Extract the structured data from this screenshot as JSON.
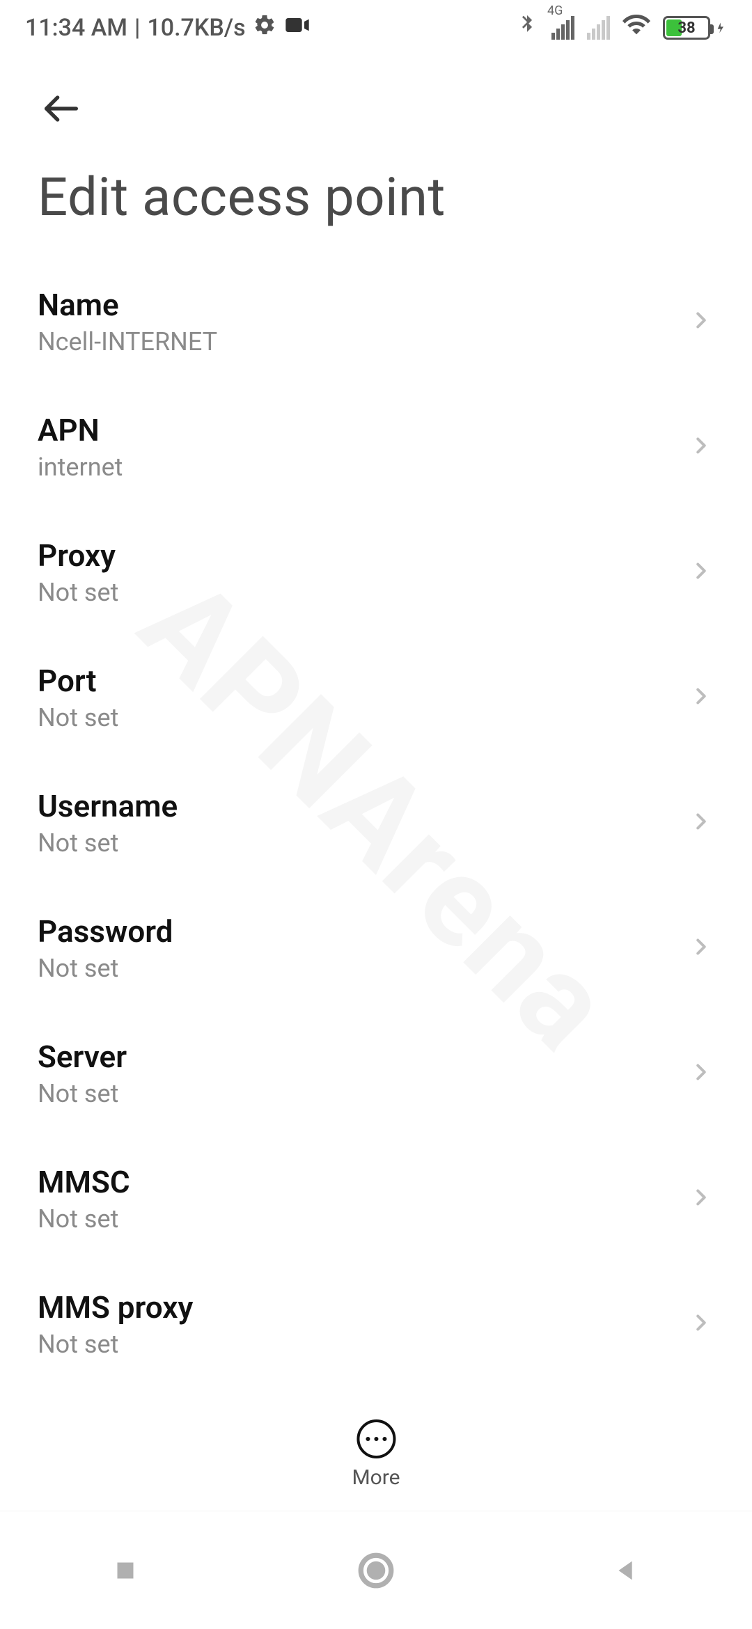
{
  "status_bar": {
    "time": "11:34 AM",
    "speed": "10.7KB/s",
    "network_label": "4G",
    "battery_percent": "38"
  },
  "header": {
    "title": "Edit access point"
  },
  "settings": [
    {
      "title": "Name",
      "value": "Ncell-INTERNET"
    },
    {
      "title": "APN",
      "value": "internet"
    },
    {
      "title": "Proxy",
      "value": "Not set"
    },
    {
      "title": "Port",
      "value": "Not set"
    },
    {
      "title": "Username",
      "value": "Not set"
    },
    {
      "title": "Password",
      "value": "Not set"
    },
    {
      "title": "Server",
      "value": "Not set"
    },
    {
      "title": "MMSC",
      "value": "Not set"
    },
    {
      "title": "MMS proxy",
      "value": "Not set"
    }
  ],
  "fab": {
    "label": "More"
  },
  "watermark": "APNArena"
}
